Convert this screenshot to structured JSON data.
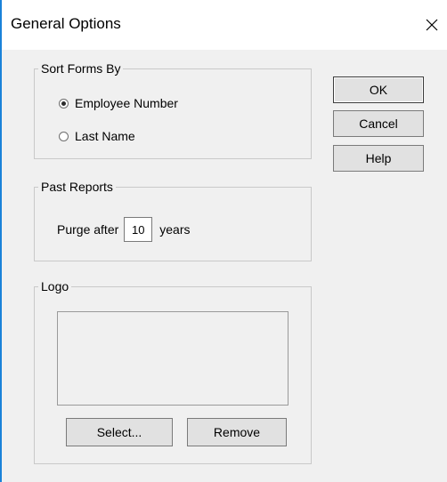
{
  "window": {
    "title": "General Options"
  },
  "sort_forms": {
    "label": "Sort Forms By",
    "options": [
      {
        "label": "Employee Number",
        "checked": true
      },
      {
        "label": "Last Name",
        "checked": false
      }
    ]
  },
  "past_reports": {
    "label": "Past Reports",
    "purge_prefix": "Purge after",
    "purge_value": "10",
    "purge_suffix": "years"
  },
  "logo": {
    "label": "Logo",
    "select_label": "Select...",
    "remove_label": "Remove"
  },
  "buttons": {
    "ok": "OK",
    "cancel": "Cancel",
    "help": "Help"
  },
  "icons": {
    "close": "close-icon"
  },
  "colors": {
    "accent_border": "#1a82d9",
    "dialog_bg": "#f0f0f0",
    "button_bg": "#e1e1e1"
  }
}
